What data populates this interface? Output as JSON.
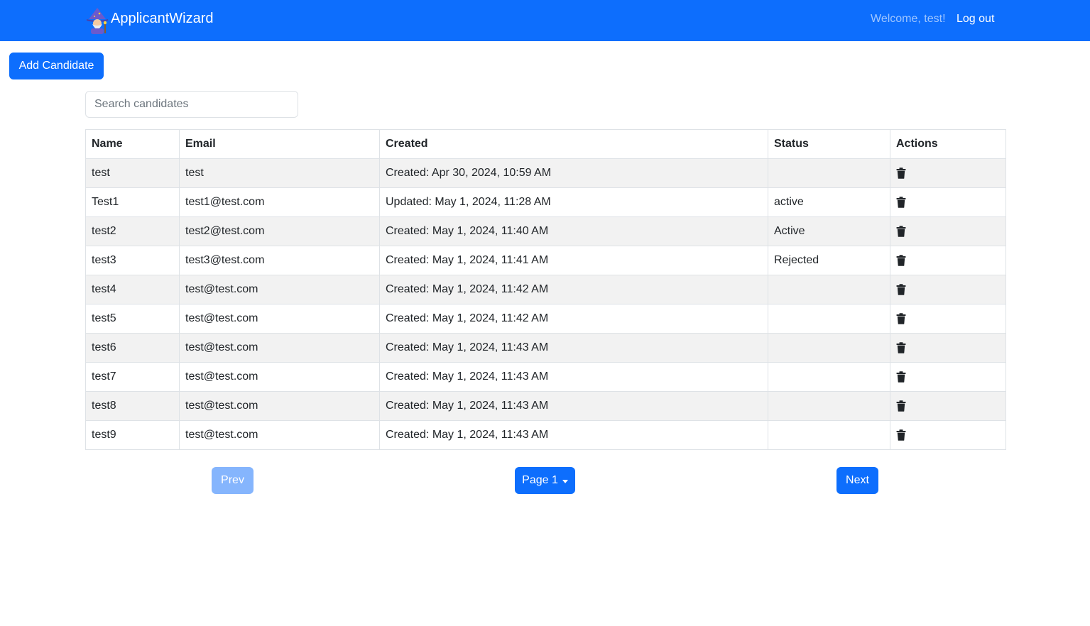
{
  "navbar": {
    "brand": "ApplicantWizard",
    "logo_icon": "wizard-icon",
    "welcome": "Welcome, test!",
    "logout": "Log out",
    "color": "#0d6efd"
  },
  "toolbar": {
    "add_candidate": "Add Candidate"
  },
  "search": {
    "placeholder": "Search candidates",
    "value": ""
  },
  "table": {
    "headers": {
      "name": "Name",
      "email": "Email",
      "created": "Created",
      "status": "Status",
      "actions": "Actions"
    },
    "action_icon": "trash-icon",
    "rows": [
      {
        "name": "test",
        "email": "test",
        "created": "Created: Apr 30, 2024, 10:59 AM",
        "status": ""
      },
      {
        "name": "Test1",
        "email": "test1@test.com",
        "created": "Updated: May 1, 2024, 11:28 AM",
        "status": "active"
      },
      {
        "name": "test2",
        "email": "test2@test.com",
        "created": "Created: May 1, 2024, 11:40 AM",
        "status": "Active"
      },
      {
        "name": "test3",
        "email": "test3@test.com",
        "created": "Created: May 1, 2024, 11:41 AM",
        "status": "Rejected"
      },
      {
        "name": "test4",
        "email": "test@test.com",
        "created": "Created: May 1, 2024, 11:42 AM",
        "status": ""
      },
      {
        "name": "test5",
        "email": "test@test.com",
        "created": "Created: May 1, 2024, 11:42 AM",
        "status": ""
      },
      {
        "name": "test6",
        "email": "test@test.com",
        "created": "Created: May 1, 2024, 11:43 AM",
        "status": ""
      },
      {
        "name": "test7",
        "email": "test@test.com",
        "created": "Created: May 1, 2024, 11:43 AM",
        "status": ""
      },
      {
        "name": "test8",
        "email": "test@test.com",
        "created": "Created: May 1, 2024, 11:43 AM",
        "status": ""
      },
      {
        "name": "test9",
        "email": "test@test.com",
        "created": "Created: May 1, 2024, 11:43 AM",
        "status": ""
      }
    ]
  },
  "pagination": {
    "prev": "Prev",
    "page": "Page 1",
    "next": "Next",
    "prev_disabled": true
  }
}
